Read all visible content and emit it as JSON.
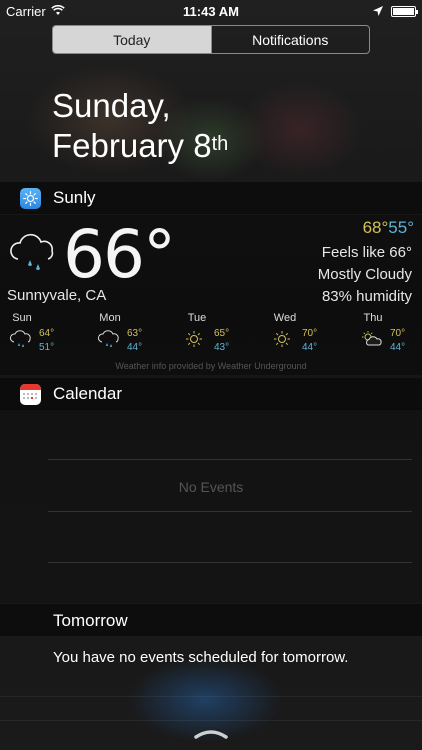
{
  "status_bar": {
    "carrier": "Carrier",
    "time": "11:43 AM",
    "battery_level": 1.0
  },
  "segmented_control": {
    "today_label": "Today",
    "notifications_label": "Notifications"
  },
  "date": {
    "line1": "Sunday,",
    "line2": "February 8",
    "suffix": "th"
  },
  "sunly": {
    "title": "Sunly",
    "current_temp": "66°",
    "location": "Sunnyvale, CA",
    "high": "68°",
    "low": "55°",
    "feels_like": "Feels like 66°",
    "condition": "Mostly Cloudy",
    "humidity": "83% humidity",
    "forecast": [
      {
        "day": "Sun",
        "high": "64°",
        "low": "51°",
        "icon": "rain-cloud-icon"
      },
      {
        "day": "Mon",
        "high": "63°",
        "low": "44°",
        "icon": "rain-cloud-icon"
      },
      {
        "day": "Tue",
        "high": "65°",
        "low": "43°",
        "icon": "sun-icon"
      },
      {
        "day": "Wed",
        "high": "70°",
        "low": "44°",
        "icon": "sun-icon"
      },
      {
        "day": "Thu",
        "high": "70°",
        "low": "44°",
        "icon": "partly-cloudy-icon"
      }
    ],
    "credit": "Weather info provided by Weather Underground"
  },
  "calendar": {
    "title": "Calendar",
    "no_events": "No Events"
  },
  "tomorrow": {
    "title": "Tomorrow",
    "message": "You have no events scheduled for tomorrow."
  },
  "colors": {
    "high_temp": "#d2c15a",
    "low_temp": "#5fb3d9",
    "sunly_icon": "#3a9ef0",
    "calendar_red": "#e5372e"
  }
}
